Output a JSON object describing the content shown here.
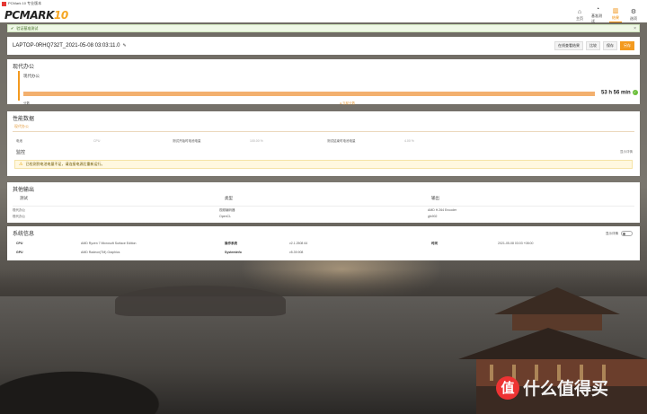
{
  "window": {
    "title": "PCMark 10 专业版本"
  },
  "header": {
    "logo_text": "PCMARK",
    "logo_num": "10",
    "nav": [
      {
        "label": "主页",
        "icon": "home-icon",
        "glyph": "⌂"
      },
      {
        "label": "基准测试",
        "icon": "gauge-icon",
        "glyph": "◔"
      },
      {
        "label": "结果",
        "icon": "chart-icon",
        "glyph": "▥"
      },
      {
        "label": "选项",
        "icon": "gear-icon",
        "glyph": "⚙"
      }
    ]
  },
  "notice": {
    "text": "验证基准测试",
    "close": "×"
  },
  "result": {
    "name": "LAPTOP-0RHQ732T_2021-05-08 03:03:11.0",
    "buttons": [
      "在线查看结果",
      "比较",
      "保存",
      "另存"
    ]
  },
  "office": {
    "title": "现代办公",
    "label": "现代办公",
    "value": "53 h 56 min",
    "row_label": "分数",
    "score_note": "● 当前分数",
    "progress": 1.0
  },
  "performance": {
    "title": "性能数据",
    "subtitle": "现代办公",
    "metrics": [
      {
        "label": "电池",
        "value": "CPU"
      },
      {
        "label": "测试开始时电池电量",
        "value": "100.00 %"
      },
      {
        "label": "测试结束时电池电量",
        "value": "4.00 %"
      }
    ],
    "monitor_label": "监控",
    "expand_label": "显示详情",
    "warning": "已检测到电池电量不足，请连接电源后重新运行。"
  },
  "output": {
    "title": "其他输出",
    "headers": [
      "测试",
      "类型",
      "输出"
    ],
    "rows": [
      [
        "现代办公",
        "视频编码器",
        "AMD H.264 Encoder"
      ],
      [
        "现代办公",
        "OpenCL",
        "gfx902"
      ]
    ]
  },
  "system": {
    "title": "系统信息",
    "toggle_label": "显示详情",
    "rows": [
      [
        "CPU",
        "AMD Ryzen 7 Microsoft Surface Edition",
        "操作系统",
        "v2.1.2508 64",
        "时间",
        "2021-05-08 03:03 +08:00"
      ],
      [
        "GPU",
        "AMD Radeon(TM) Graphics",
        "SystemInfo",
        "v5.39.908",
        "",
        ""
      ]
    ]
  },
  "watermark": {
    "text": "什么值得买",
    "badge": "值"
  },
  "colors": {
    "accent": "#f39a1f",
    "success": "#6bbf3a",
    "bar": "#f3b06e"
  }
}
